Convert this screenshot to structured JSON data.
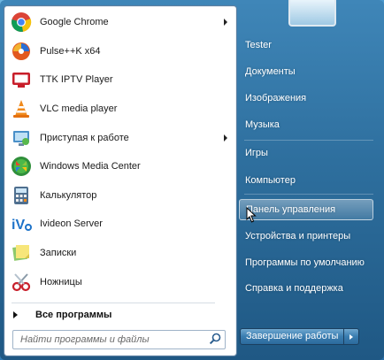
{
  "programs": [
    {
      "label": "Google Chrome",
      "icon": "chrome-icon",
      "has_submenu": true
    },
    {
      "label": "Pulse++K x64",
      "icon": "pulse-icon",
      "has_submenu": false
    },
    {
      "label": "TTK IPTV Player",
      "icon": "tv-icon",
      "has_submenu": false
    },
    {
      "label": "VLC media player",
      "icon": "vlc-icon",
      "has_submenu": false
    },
    {
      "label": "Приступая к работе",
      "icon": "getting-started-icon",
      "has_submenu": true
    },
    {
      "label": "Windows Media Center",
      "icon": "media-center-icon",
      "has_submenu": false
    },
    {
      "label": "Калькулятор",
      "icon": "calculator-icon",
      "has_submenu": false
    },
    {
      "label": "Ivideon Server",
      "icon": "ivideon-icon",
      "has_submenu": false
    },
    {
      "label": "Записки",
      "icon": "sticky-notes-icon",
      "has_submenu": false
    },
    {
      "label": "Ножницы",
      "icon": "scissors-icon",
      "has_submenu": false
    }
  ],
  "all_programs_label": "Все программы",
  "search": {
    "placeholder": "Найти программы и файлы"
  },
  "right_items": [
    {
      "label": "Tester"
    },
    {
      "label": "Документы"
    },
    {
      "label": "Изображения"
    },
    {
      "label": "Музыка"
    },
    {
      "label": "Игры"
    },
    {
      "label": "Компьютер"
    },
    {
      "label": "Панель управления",
      "highlighted": true
    },
    {
      "label": "Устройства и принтеры"
    },
    {
      "label": "Программы по умолчанию"
    },
    {
      "label": "Справка и поддержка"
    }
  ],
  "shutdown_label": "Завершение работы",
  "colors": {
    "accent": "#2e6f9e",
    "panel_bg": "#ffffff",
    "right_text": "#ffffff"
  }
}
